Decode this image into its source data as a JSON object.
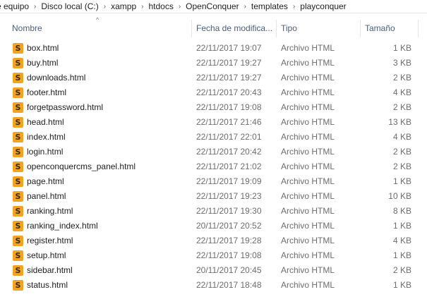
{
  "breadcrumb": [
    "e equipo",
    "Disco local (C:)",
    "xampp",
    "htdocs",
    "OpenConquer",
    "templates",
    "playconquer"
  ],
  "columns": {
    "name": "Nombre",
    "date": "Fecha de modifica...",
    "type": "Tipo",
    "size": "Tamaño"
  },
  "sort_indicator": "^",
  "file_icon": "sublime-text-file-icon",
  "files": [
    {
      "name": "box.html",
      "date": "22/11/2017 19:07",
      "type": "Archivo HTML",
      "size": "1 KB"
    },
    {
      "name": "buy.html",
      "date": "22/11/2017 19:27",
      "type": "Archivo HTML",
      "size": "3 KB"
    },
    {
      "name": "downloads.html",
      "date": "22/11/2017 19:27",
      "type": "Archivo HTML",
      "size": "2 KB"
    },
    {
      "name": "footer.html",
      "date": "22/11/2017 20:43",
      "type": "Archivo HTML",
      "size": "4 KB"
    },
    {
      "name": "forgetpassword.html",
      "date": "22/11/2017 19:08",
      "type": "Archivo HTML",
      "size": "2 KB"
    },
    {
      "name": "head.html",
      "date": "22/11/2017 21:46",
      "type": "Archivo HTML",
      "size": "13 KB"
    },
    {
      "name": "index.html",
      "date": "22/11/2017 22:01",
      "type": "Archivo HTML",
      "size": "4 KB"
    },
    {
      "name": "login.html",
      "date": "22/11/2017 20:42",
      "type": "Archivo HTML",
      "size": "2 KB"
    },
    {
      "name": "openconquercms_panel.html",
      "date": "22/11/2017 21:02",
      "type": "Archivo HTML",
      "size": "2 KB"
    },
    {
      "name": "page.html",
      "date": "22/11/2017 19:09",
      "type": "Archivo HTML",
      "size": "1 KB"
    },
    {
      "name": "panel.html",
      "date": "22/11/2017 19:23",
      "type": "Archivo HTML",
      "size": "10 KB"
    },
    {
      "name": "ranking.html",
      "date": "22/11/2017 19:30",
      "type": "Archivo HTML",
      "size": "8 KB"
    },
    {
      "name": "ranking_index.html",
      "date": "20/11/2017 20:52",
      "type": "Archivo HTML",
      "size": "1 KB"
    },
    {
      "name": "register.html",
      "date": "22/11/2017 19:28",
      "type": "Archivo HTML",
      "size": "4 KB"
    },
    {
      "name": "setup.html",
      "date": "22/11/2017 19:08",
      "type": "Archivo HTML",
      "size": "1 KB"
    },
    {
      "name": "sidebar.html",
      "date": "20/11/2017 20:45",
      "type": "Archivo HTML",
      "size": "2 KB"
    },
    {
      "name": "status.html",
      "date": "22/11/2017 18:48",
      "type": "Archivo HTML",
      "size": "1 KB"
    }
  ]
}
